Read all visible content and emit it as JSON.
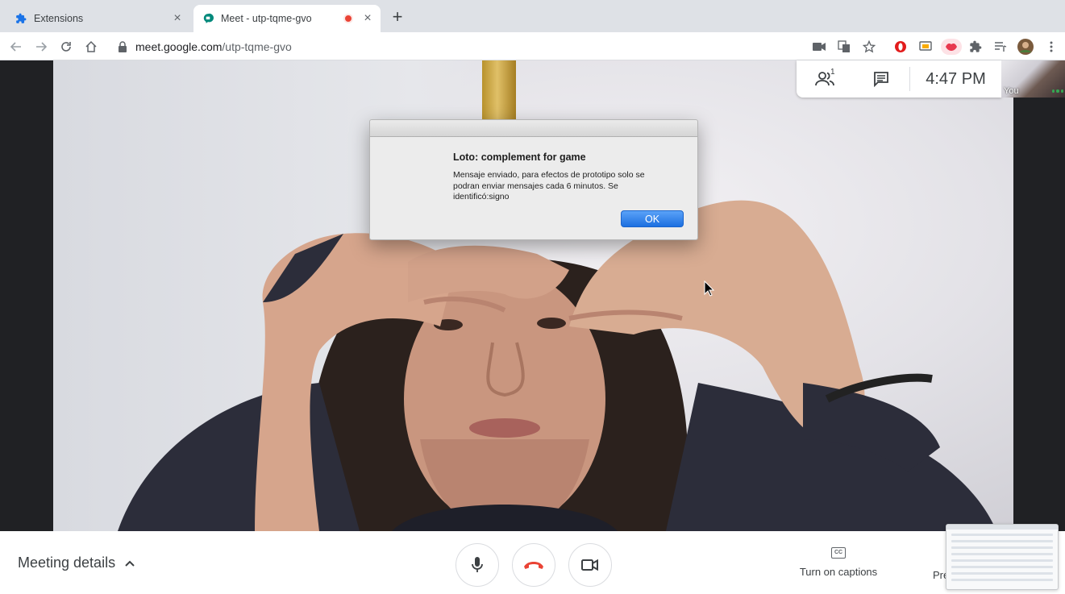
{
  "browser": {
    "tabs": [
      {
        "title": "Extensions",
        "active": false,
        "icon": "puzzle-icon"
      },
      {
        "title": "Meet - utp-tqme-gvo",
        "active": true,
        "icon": "meet-icon",
        "recording": true
      }
    ],
    "url_host": "meet.google.com",
    "url_path": "/utp-tqme-gvo"
  },
  "meeting": {
    "participants_count": "1",
    "time": "4:47 PM",
    "self_label": "You"
  },
  "dialog": {
    "title": "Loto: complement for game",
    "message": "Mensaje enviado, para efectos de prototipo solo se podran enviar mensajes cada 6 minutos. Se identificó:signo",
    "ok_label": "OK"
  },
  "bottom": {
    "meeting_details_label": "Meeting details",
    "captions_label": "Turn on captions",
    "captions_icon_text": "CC",
    "present_label": "Pre"
  },
  "colors": {
    "hangup": "#ea4335",
    "accent_blue": "#1a73e8"
  }
}
